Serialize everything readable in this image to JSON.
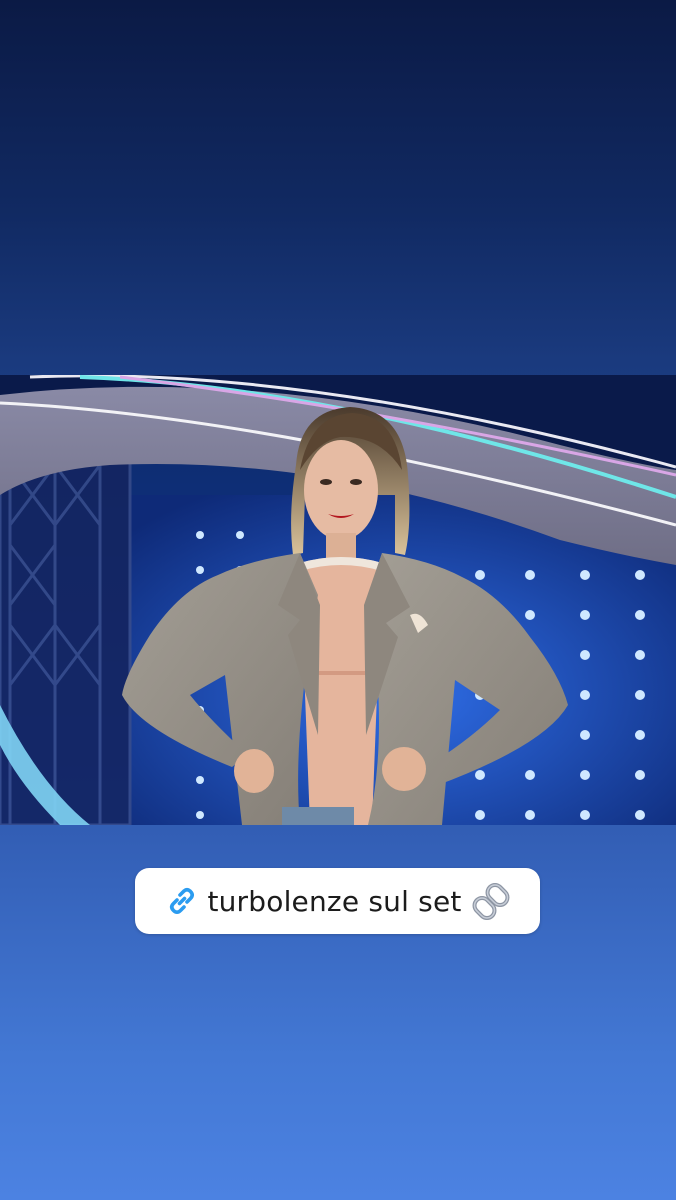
{
  "story": {
    "background": {
      "top_color": "#0b1a45",
      "bottom_color": "#4c82e2"
    },
    "photo": {
      "icon": "tv-show-stage-photo"
    },
    "link_sticker": {
      "label": "turbolenze sul set",
      "leading_icon": "link-icon",
      "trailing_icon": "chain-emoji-icon",
      "accent_color": "#2b9cf0"
    }
  }
}
